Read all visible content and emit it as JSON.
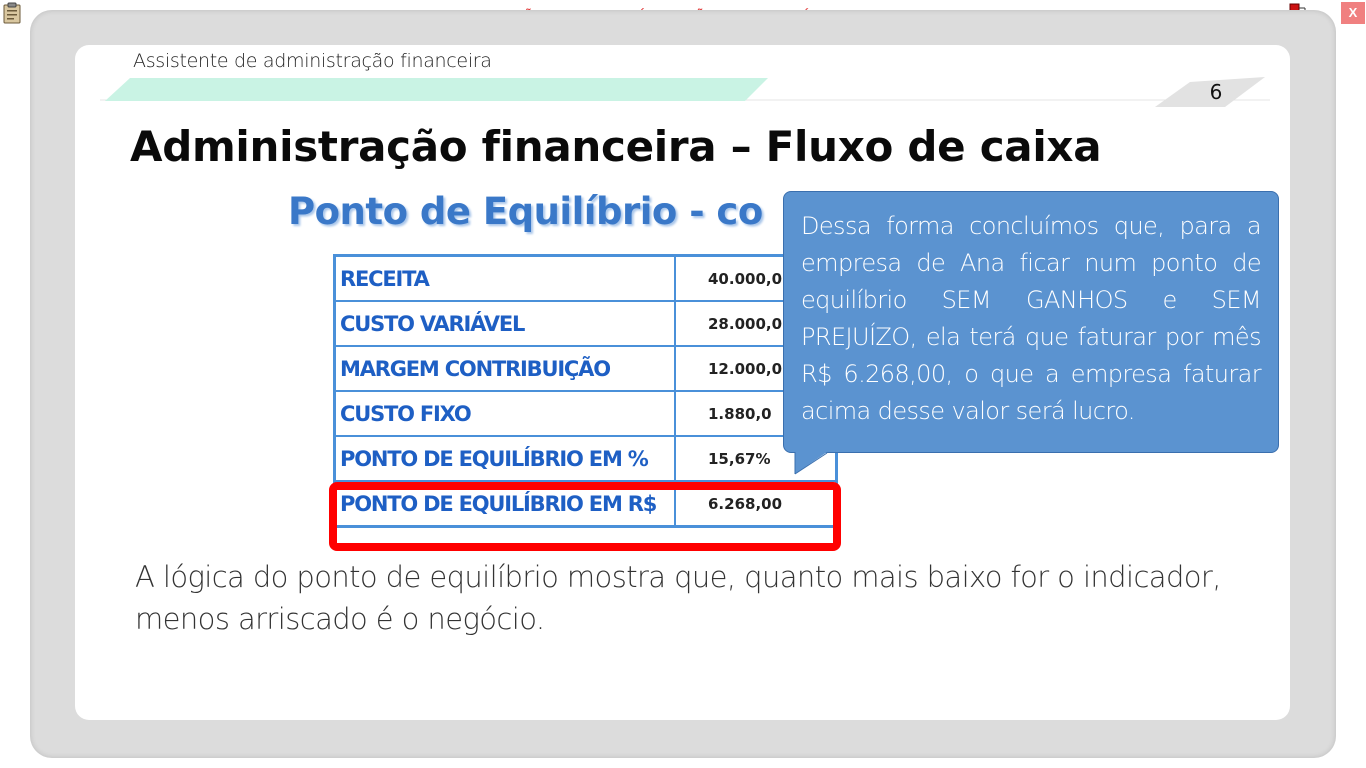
{
  "top_bar": {
    "banner": "VERSÃO PARA FUNCIONÁRIOS - NÃO COMERCIALIZÁVEL",
    "close_label": "X"
  },
  "slide": {
    "subtitle": "Assistente de administração financeira",
    "page_number": "6",
    "title": "Administração financeira – Fluxo de caixa",
    "image_title": "Ponto de Equilíbrio - co",
    "table": [
      {
        "label": "RECEITA",
        "value": "40.000,0"
      },
      {
        "label": "CUSTO VARIÁVEL",
        "value": "28.000,0"
      },
      {
        "label": "MARGEM CONTRIBUIÇÃO",
        "value": "12.000,0"
      },
      {
        "label": "CUSTO FIXO",
        "value": "1.880,0"
      },
      {
        "label": "PONTO DE EQUILÍBRIO EM  %",
        "value": "15,67%"
      },
      {
        "label": "PONTO DE EQUILÍBRIO EM R$",
        "value": "6.268,00"
      }
    ],
    "callout": "Dessa forma concluímos que, para a empresa de Ana ficar num ponto de equilíbrio SEM GANHOS e SEM PREJUÍZO, ela terá que faturar por mês R$ 6.268,00, o que a empresa faturar acima desse valor será lucro.",
    "body": "A lógica do ponto de equilíbrio mostra que, quanto mais baixo for o indicador, menos arriscado é o negócio."
  },
  "colors": {
    "banner_text": "#e03030",
    "table_label": "#1e5fc4",
    "callout_bg": "#5b93d0",
    "highlight": "#ff0000"
  }
}
